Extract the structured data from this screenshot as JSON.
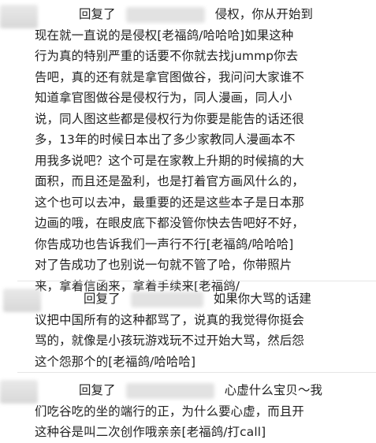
{
  "comments": [
    {
      "reply_label": "回复了",
      "lines": [
        "侵权，你从开始到",
        "现在就一直说的是侵权[老福鸽/哈哈哈]如果这种",
        "行为真的特别严重的话要不你就去找jummp你去",
        "告吧，真的还有就是拿官图做谷，我问问大家谁不",
        "知道拿官图做谷是侵权行为，同人漫画，同人小",
        "说，同人图这些都是侵权行为你要是能告的话还很",
        "多，13年的时候日本出了多少家教同人漫画本不",
        "用我多说吧？这个可是在家教上升期的时候搞的大",
        "面积，而且还是盈利，也是打着官方画风什么的，",
        "这个也可以去冲，最重要的还是这些本子是日本那",
        "边画的哦，在眼皮底下都没管你快去告吧好不好，",
        "你告成功也告诉我们一声行不行[老福鸽/哈哈哈]",
        "对了告成功了也别说一句就不管了哈，你带照片",
        "来，拿着信函来，拿着手续来[老福鸽/"
      ]
    },
    {
      "reply_label": "回复了",
      "lines": [
        "如果你大骂的话建",
        "议把中国所有的这种都骂了，说真的我觉得你挺会",
        "骂的，就像是小孩玩游戏玩不过开始大骂，然后怨",
        "这个怨那个的[老福鸽/哈哈哈]"
      ]
    },
    {
      "reply_label": "回复了",
      "lines": [
        "心虚什么宝贝～我",
        "们吃谷吃的坐的端行的正，为什么要心虚，而且开",
        "这种谷是叫二次创作哦亲亲[老福鸽/打call]"
      ]
    }
  ]
}
